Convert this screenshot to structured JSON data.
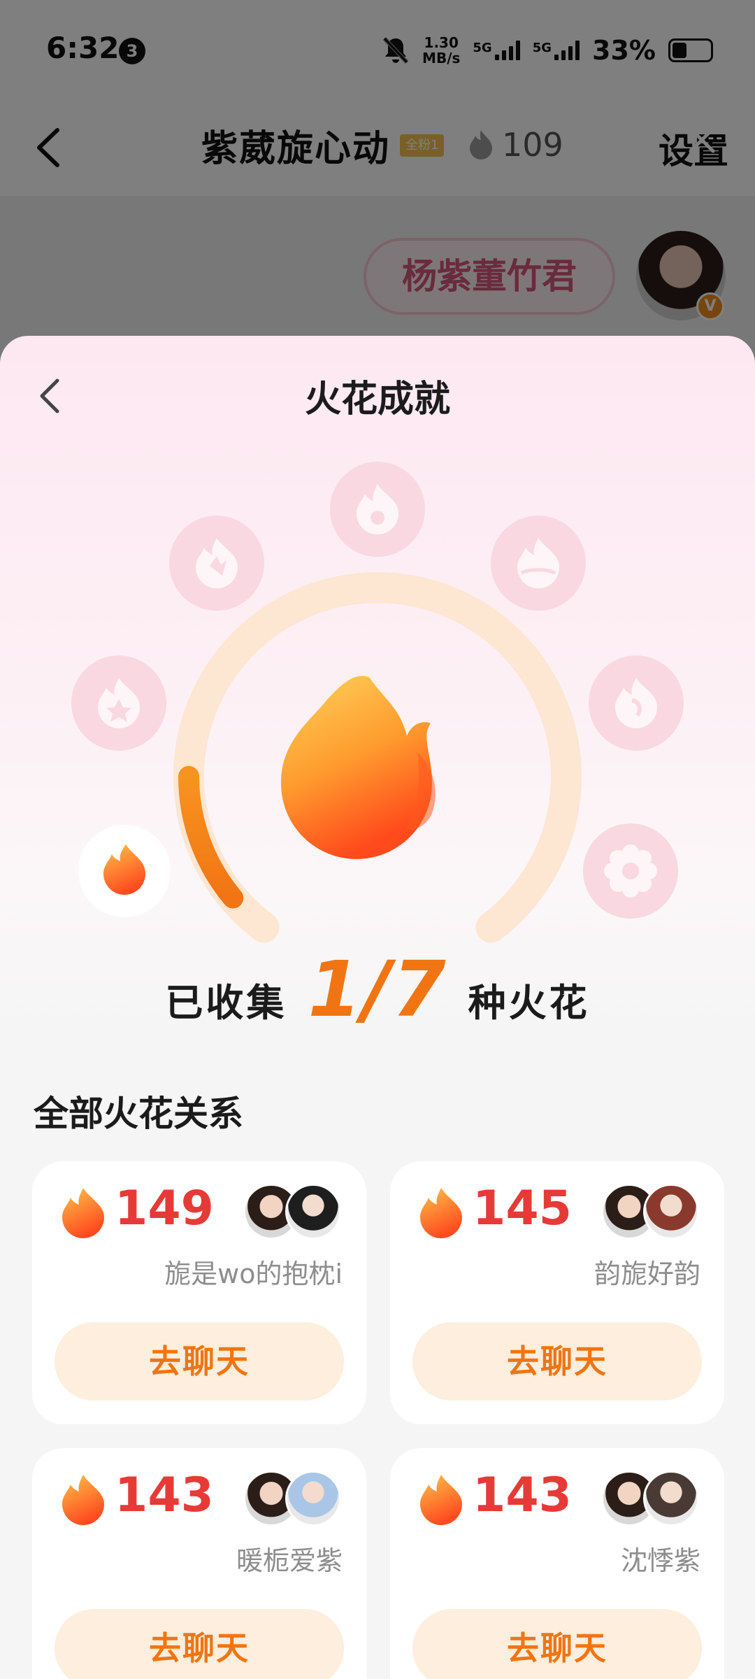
{
  "status_bar": {
    "time": "6:32",
    "notification_count": "3",
    "speed_value": "1.30",
    "speed_unit": "MB/s",
    "network_1": "5G",
    "network_2": "5G",
    "battery": "33%"
  },
  "chat_header": {
    "title": "紫葳旋心动",
    "fan_badge": "全粉1",
    "spark_count": "109",
    "settings_label": "设置"
  },
  "chat_preview": {
    "bubble_text": "杨紫董竹君",
    "badge": "V"
  },
  "sheet": {
    "title": "火花成就",
    "collected_prefix": "已收集",
    "collected_count": "1/7",
    "collected_suffix": "种火花",
    "collected_progress": 0.1429,
    "section_title": "全部火花关系"
  },
  "relations": [
    {
      "count": "149",
      "name": "旎是wo的抱枕i",
      "button": "去聊天",
      "avatar_color": "#1e1e1e"
    },
    {
      "count": "145",
      "name": "韵旎好韵",
      "button": "去聊天",
      "avatar_color": "#8a3a2c"
    },
    {
      "count": "143",
      "name": "暖栀爱紫",
      "button": "去聊天",
      "avatar_color": "#a9c6e6"
    },
    {
      "count": "143",
      "name": "沈悸紫",
      "button": "去聊天",
      "avatar_color": "#4a3a36"
    }
  ],
  "colors": {
    "accent_orange": "#f07512",
    "count_red": "#e63a37",
    "locked_pink": "#f9d8e2"
  }
}
